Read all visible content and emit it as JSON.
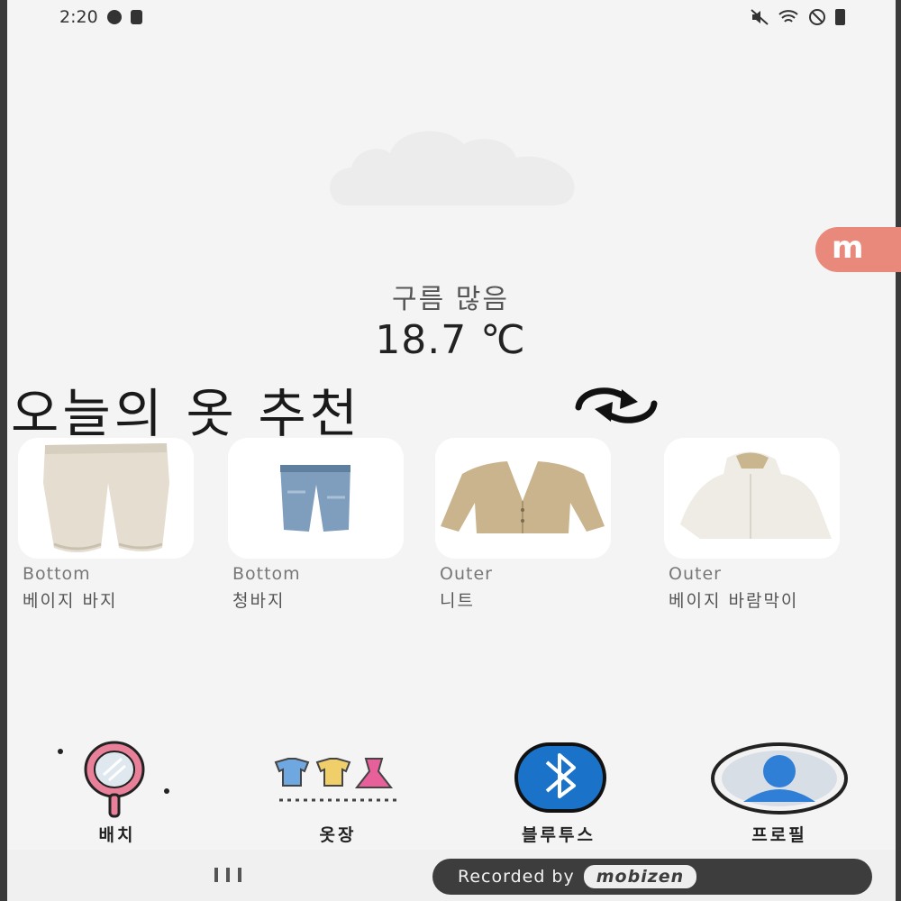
{
  "status_bar": {
    "time": "2:20"
  },
  "weather": {
    "description": "구름 많음",
    "temperature": "18.7 ℃"
  },
  "floating": {
    "logo_letter": "m"
  },
  "recommendation": {
    "title": "오늘의 옷 추천",
    "items": [
      {
        "category": "Bottom",
        "name": "베이지 바지",
        "image": "beige-pants"
      },
      {
        "category": "Bottom",
        "name": "청바지",
        "image": "jeans"
      },
      {
        "category": "Outer",
        "name": "니트",
        "image": "knit-cardigan"
      },
      {
        "category": "Outer",
        "name": "베이지 바람막이",
        "image": "fleece-jacket"
      }
    ]
  },
  "bottom_nav": [
    {
      "label": "배치",
      "icon": "mirror-icon"
    },
    {
      "label": "옷장",
      "icon": "clothes-icon"
    },
    {
      "label": "블루투스",
      "icon": "bluetooth-icon"
    },
    {
      "label": "프로필",
      "icon": "profile-icon"
    }
  ],
  "system_bar": {
    "recorded_prefix": "Recorded by",
    "recorded_brand": "mobizen"
  },
  "colors": {
    "background": "#f4f4f4",
    "bluetooth": "#1a73c9",
    "profile": "#2f7fd6",
    "mirror": "#e8809a"
  }
}
